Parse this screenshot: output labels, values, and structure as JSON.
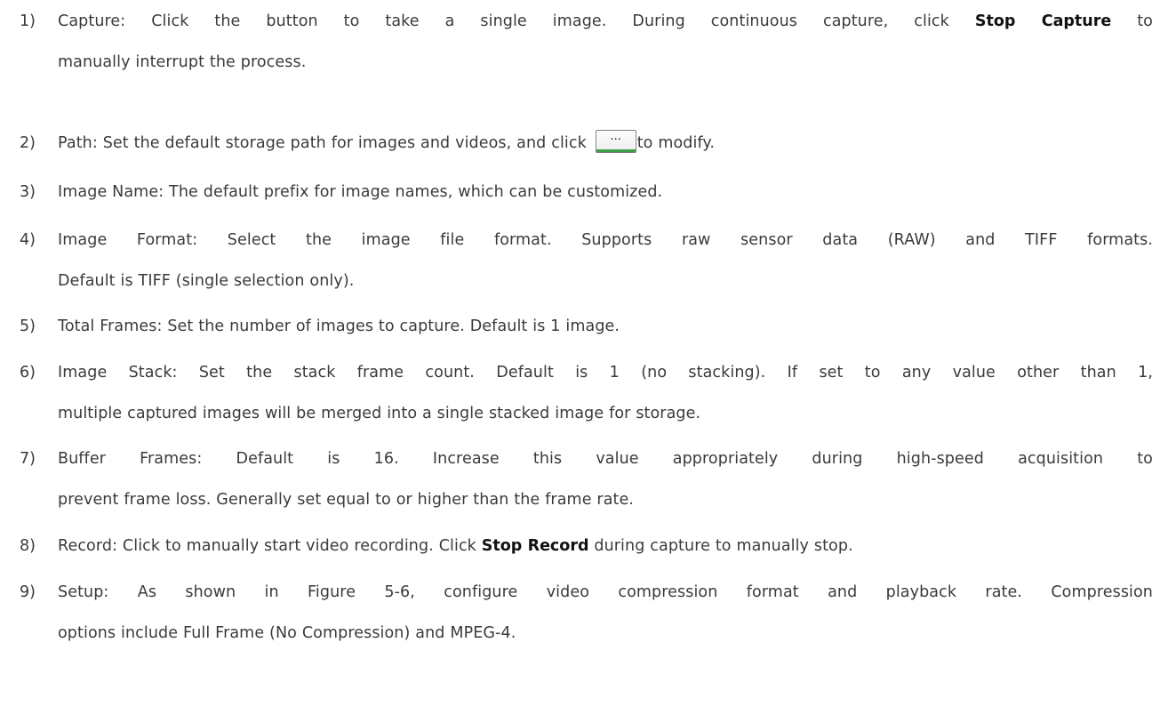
{
  "items": [
    {
      "num": "1)",
      "line1_pre": "Capture: Click the button to take a single image. During continuous capture, click ",
      "line1_bold": "Stop Capture",
      "line1_post": " to",
      "line2": "manually interrupt the process."
    },
    {
      "num": "2)",
      "text_pre": "Path: Set the default storage path for images and videos, and click ",
      "button_label": "...",
      "text_post": "to modify."
    },
    {
      "num": "3)",
      "text": "Image Name: The default prefix for image names, which can be customized."
    },
    {
      "num": "4)",
      "line1": "Image Format: Select the image file format. Supports raw sensor data (RAW) and TIFF formats.",
      "line2": "Default is TIFF (single selection only)."
    },
    {
      "num": "5)",
      "text": "Total Frames: Set the number of images to capture. Default is 1 image."
    },
    {
      "num": "6)",
      "line1": "Image Stack: Set the stack frame count. Default is 1 (no stacking). If set to any value other than 1,",
      "line2": "multiple captured images will be merged into a single stacked image for storage."
    },
    {
      "num": "7)",
      "line1": "Buffer Frames: Default is 16. Increase this value appropriately during high-speed acquisition to",
      "line2": "prevent frame loss. Generally set equal to or higher than the frame rate."
    },
    {
      "num": "8)",
      "text_pre": "Record: Click to manually start video recording. Click ",
      "text_bold": "Stop Record",
      "text_post": " during capture to manually stop."
    },
    {
      "num": "9)",
      "line1": "Setup: As shown in Figure 5-6, configure video compression format and playback rate. Compression",
      "line2": "options include Full Frame (No Compression) and MPEG-4."
    }
  ]
}
